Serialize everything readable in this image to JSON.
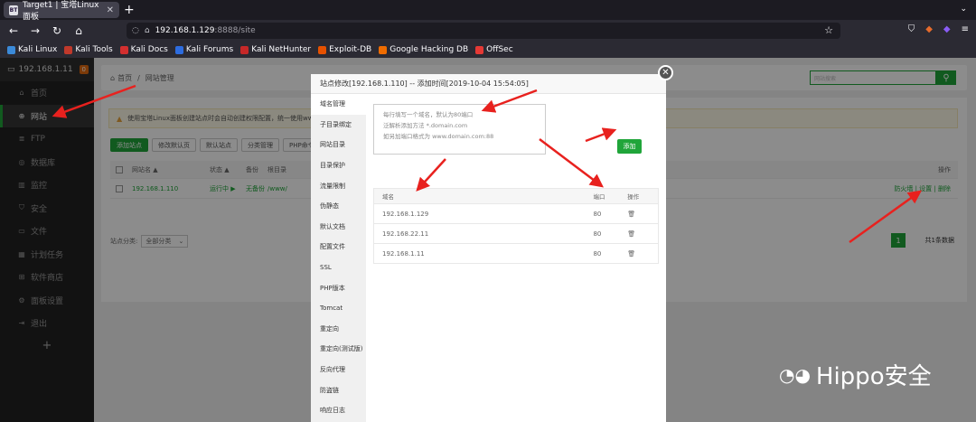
{
  "browser": {
    "tab_title": "Target1 | 宝塔Linux面板",
    "tab_favicon": "BT",
    "url_host": "192.168.1.129",
    "url_path": ":8888/site",
    "bookmarks": [
      "Kali Linux",
      "Kali Tools",
      "Kali Docs",
      "Kali Forums",
      "Kali NetHunter",
      "Exploit-DB",
      "Google Hacking DB",
      "OffSec"
    ]
  },
  "sidebar": {
    "host": "192.168.1.11",
    "badge": "0",
    "items": [
      {
        "label": "首页",
        "icon": "home-icon"
      },
      {
        "label": "网站",
        "icon": "globe-icon"
      },
      {
        "label": "FTP",
        "icon": "ftp-icon"
      },
      {
        "label": "数据库",
        "icon": "database-icon"
      },
      {
        "label": "监控",
        "icon": "monitor-icon"
      },
      {
        "label": "安全",
        "icon": "shield-icon"
      },
      {
        "label": "文件",
        "icon": "folder-icon"
      },
      {
        "label": "计划任务",
        "icon": "calendar-icon"
      },
      {
        "label": "软件商店",
        "icon": "grid-icon"
      },
      {
        "label": "面板设置",
        "icon": "gear-icon"
      },
      {
        "label": "退出",
        "icon": "logout-icon"
      }
    ],
    "active_index": 1
  },
  "main": {
    "breadcrumb_home": "首页",
    "breadcrumb_sep": "/",
    "breadcrumb_current": "网站管理",
    "search_placeholder": "网站搜索",
    "warning": "使用宝塔Linux面板创建站点时会自动创建权限配置，统一使用www/",
    "buttons": [
      "添加站点",
      "修改默认页",
      "默认站点",
      "分类管理",
      "PHP命令行版"
    ],
    "headers": {
      "name": "网站名 ▲",
      "status": "状态 ▲",
      "backup": "备份",
      "root": "根目录",
      "ops": "操作"
    },
    "row": {
      "name": "192.168.1.110",
      "status": "运行中 ▶",
      "backup": "无备份",
      "root": "/www/",
      "ops": "防火墙 | 设置 | 删除"
    },
    "category_label": "站点分类:",
    "category_value": "全部分类",
    "page_num": "1",
    "page_total": "共1条数据"
  },
  "modal": {
    "title": "站点修改[192.168.1.110] -- 添加时间[2019-10-04 15:54:05]",
    "tabs": [
      "域名管理",
      "子目录绑定",
      "网站目录",
      "目录保护",
      "流量限制",
      "伪静态",
      "默认文档",
      "配置文件",
      "SSL",
      "PHP版本",
      "Tomcat",
      "重定向",
      "重定向(测试版)",
      "反向代理",
      "防盗链",
      "响应日志"
    ],
    "textarea_lines": [
      "每行填写一个域名，默认为80端口",
      "泛解析添加方法 *.domain.com",
      "如另加端口格式为 www.domain.com:88"
    ],
    "add_button": "添加",
    "table_headers": {
      "domain": "域名",
      "port": "端口",
      "ops": "操作"
    },
    "domains": [
      {
        "domain": "192.168.1.129",
        "port": "80"
      },
      {
        "domain": "192.168.22.11",
        "port": "80"
      },
      {
        "domain": "192.168.1.11",
        "port": "80"
      }
    ]
  },
  "watermark": "Hippo安全"
}
